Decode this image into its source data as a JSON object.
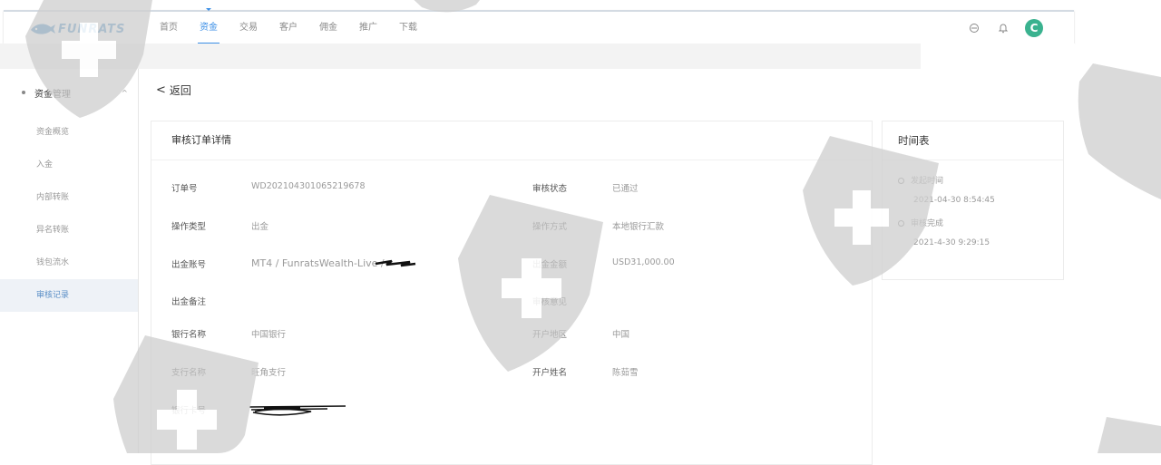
{
  "header": {
    "logo_text": "FUNRATS",
    "nav": [
      "首页",
      "资金",
      "交易",
      "客户",
      "佣金",
      "推广",
      "下载"
    ],
    "active_nav": 1,
    "avatar_letter": "C"
  },
  "sidebar": {
    "group": "资金管理",
    "items": [
      "资金概览",
      "入金",
      "内部转账",
      "异名转账",
      "钱包流水",
      "审核记录"
    ],
    "active_item": 5
  },
  "back_label": "返回",
  "detail": {
    "title": "审核订单详情",
    "rows": [
      {
        "l1": "订单号",
        "v1": "WD20210430106521967​8",
        "l2": "审核状态",
        "v2": "已通过"
      },
      {
        "l1": "操作类型",
        "v1": "出金",
        "l2": "操作方式",
        "v2": "本地银行汇款"
      },
      {
        "l1": "出金账号",
        "v1": "MT4 / FunratsWealth-Live /",
        "l2": "出金金额",
        "v2": "USD31,000.00"
      },
      {
        "l1": "出金备注",
        "v1": "",
        "l2": "审核意见",
        "v2": ""
      },
      {
        "l1": "银行名称",
        "v1": "中国银行",
        "l2": "开户地区",
        "v2": "中国"
      },
      {
        "l1": "支行名称",
        "v1": "旺角支行",
        "l2": "开户姓名",
        "v2": "陈茹雪"
      },
      {
        "l1": "银行卡号",
        "v1": "",
        "l2": "",
        "v2": ""
      }
    ]
  },
  "timeline": {
    "title": "时间表",
    "events": [
      {
        "label": "发起时间",
        "time": "2021-04-30  8:54:45"
      },
      {
        "label": "审核完成",
        "time": "2021-4-30  9:29:15"
      }
    ]
  }
}
